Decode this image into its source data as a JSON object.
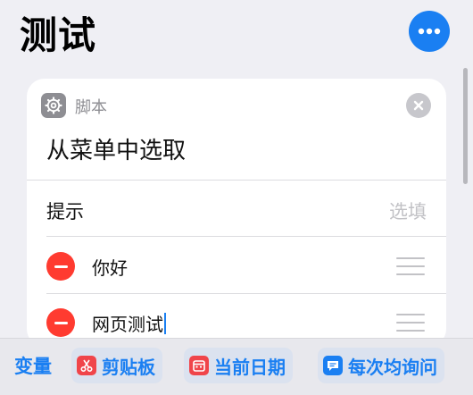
{
  "header": {
    "title": "测试",
    "more_icon": "ellipsis-icon"
  },
  "card": {
    "app_icon": "gear-icon",
    "app_name": "脚本",
    "close_icon": "close-icon",
    "action_title": "从菜单中选取",
    "prompt": {
      "label": "提示",
      "placeholder": "选填"
    },
    "items": [
      {
        "label": "你好",
        "remove_icon": "minus-icon",
        "handle_icon": "drag-handle-icon"
      },
      {
        "label": "网页测试",
        "remove_icon": "minus-icon",
        "handle_icon": "drag-handle-icon"
      }
    ]
  },
  "variables_bar": {
    "label": "变量",
    "chips": [
      {
        "label": "剪贴板",
        "icon": "scissors-icon",
        "color": "#f0454a"
      },
      {
        "label": "当前日期",
        "icon": "calendar-icon",
        "color": "#f0454a"
      },
      {
        "label": "每次均询问",
        "icon": "chat-bubble-icon",
        "color": "#1a7ff2"
      }
    ]
  },
  "colors": {
    "accent": "#1a7ff2",
    "destructive": "#ff3b30",
    "background": "#efeff4"
  }
}
